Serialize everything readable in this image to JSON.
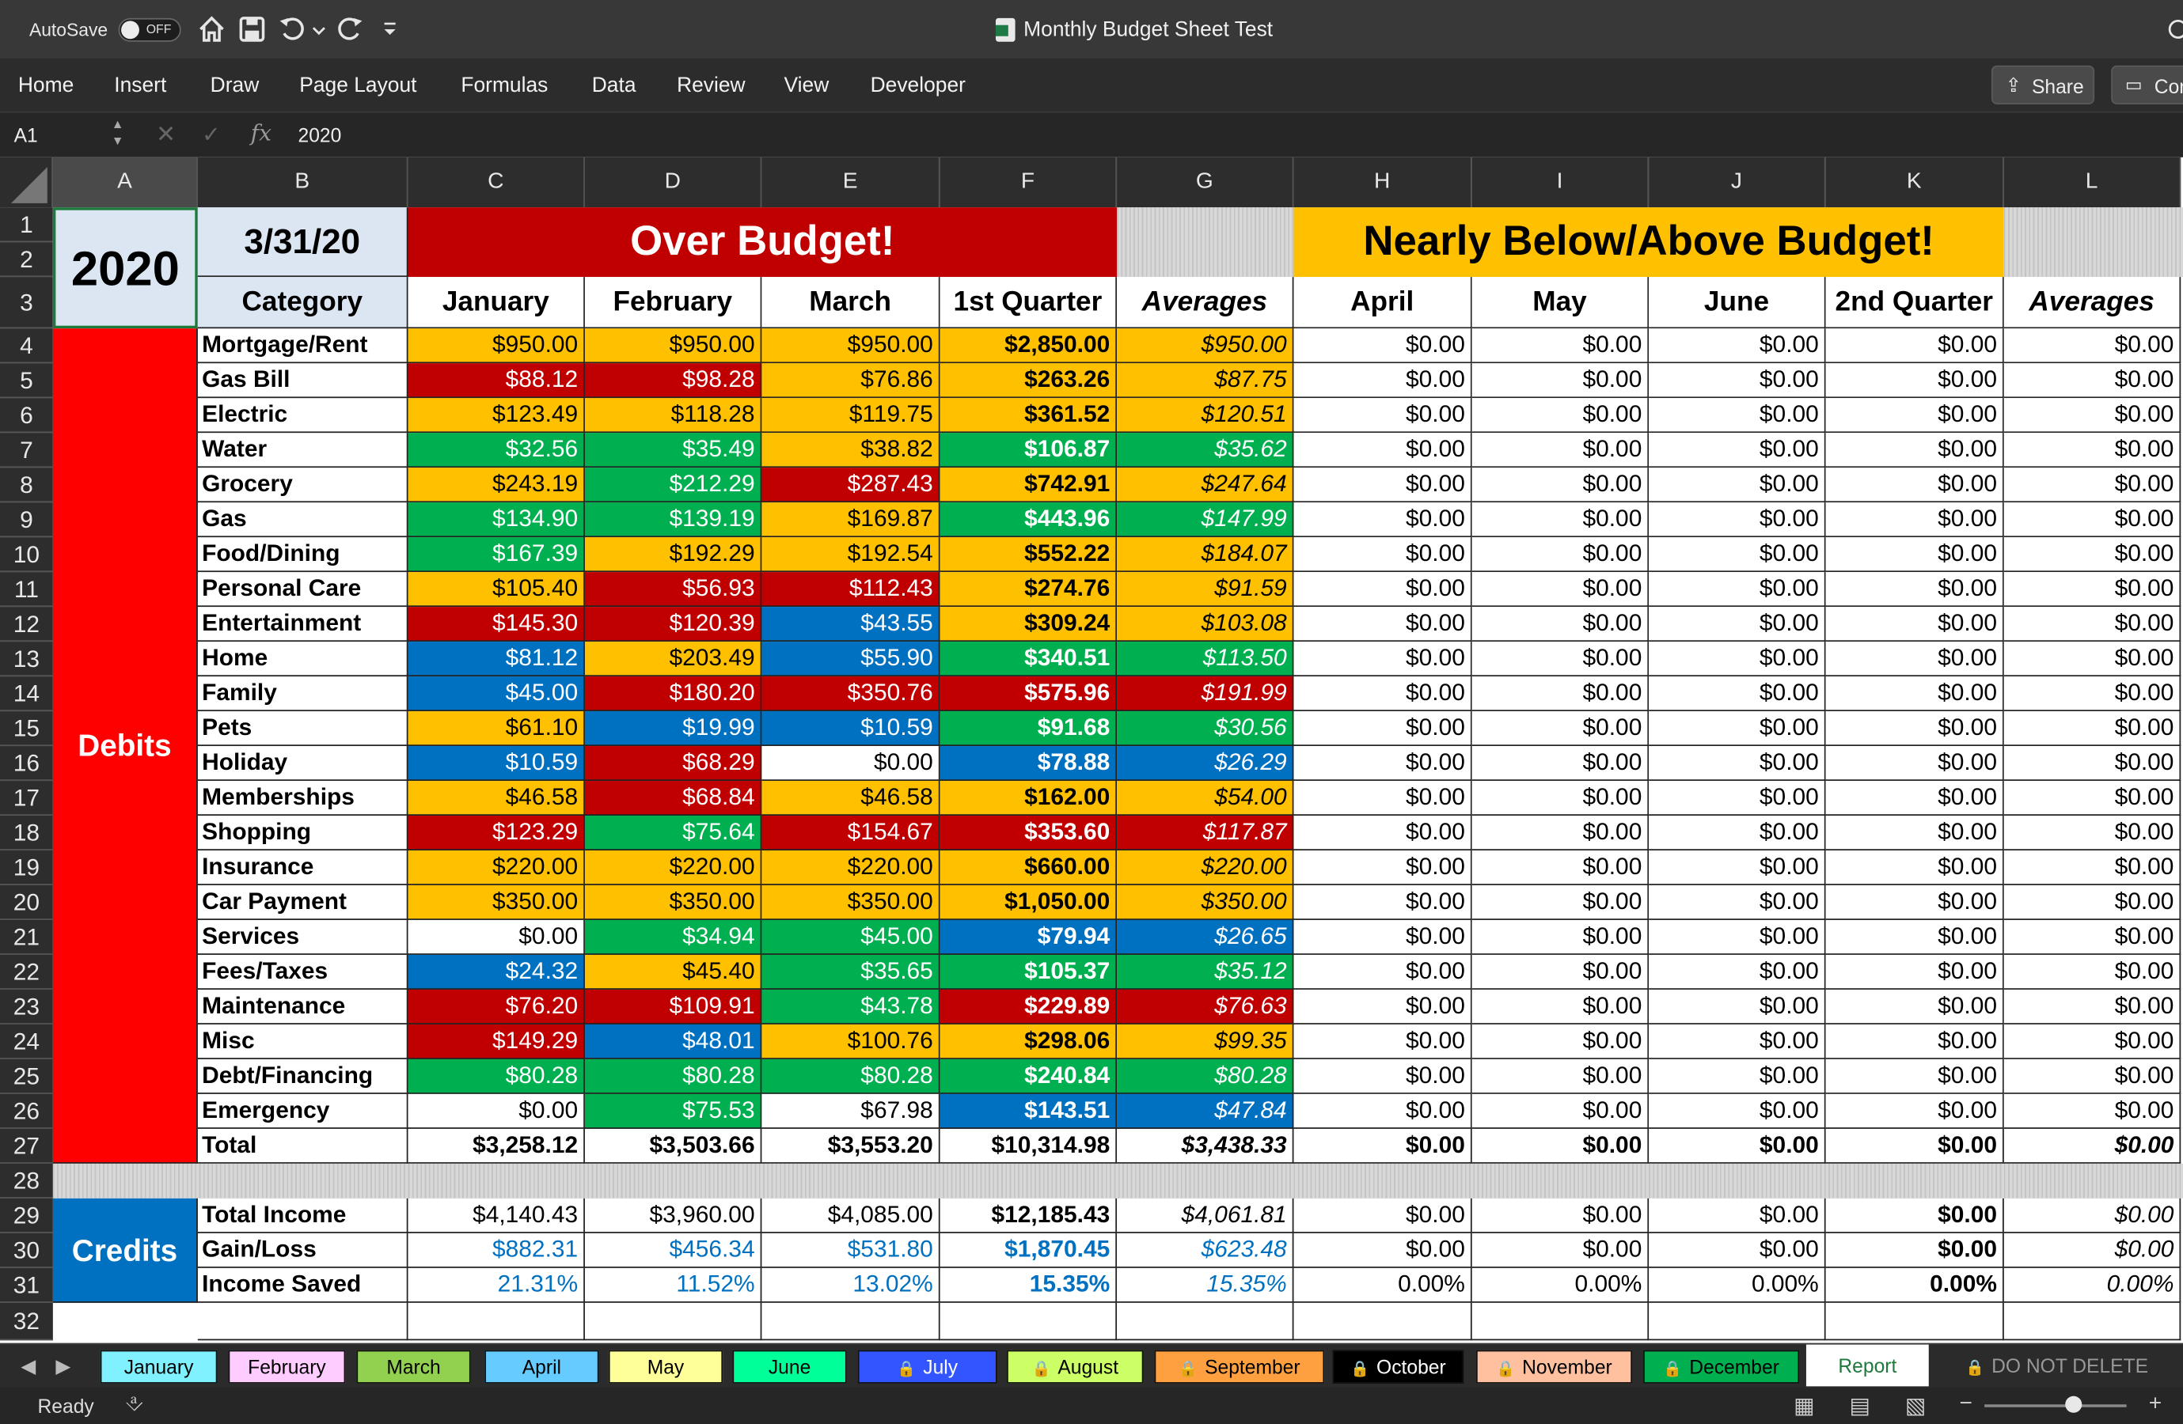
{
  "window": {
    "title": "Monthly Budget Sheet Test",
    "autosave_label": "AutoSave",
    "autosave_state": "OFF"
  },
  "icons": [
    "home-icon",
    "save-icon",
    "undo-icon",
    "redo-icon",
    "customize-icon",
    "share-icon",
    "comment-icon",
    "fx-icon"
  ],
  "ribbon": {
    "tabs": [
      "Home",
      "Insert",
      "Draw",
      "Page Layout",
      "Formulas",
      "Data",
      "Review",
      "View",
      "Developer"
    ],
    "share_label": "Share",
    "comments_label": "Con"
  },
  "formula_bar": {
    "cell_ref": "A1",
    "formula": "2020",
    "fx_label": "fx"
  },
  "columns": [
    "A",
    "B",
    "C",
    "D",
    "E",
    "F",
    "G",
    "H",
    "I",
    "J",
    "K",
    "L"
  ],
  "sheet": {
    "year": "2020",
    "date": "3/31/20",
    "over_banner": "Over Budget!",
    "nearly_banner": "Nearly Below/Above Budget!",
    "headers": [
      "Category",
      "January",
      "February",
      "March",
      "1st Quarter",
      "Averages",
      "April",
      "May",
      "June",
      "2nd Quarter",
      "Averages"
    ],
    "debits_label": "Debits",
    "credits_label": "Credits",
    "debit_rows": [
      {
        "cat": "Mortgage/Rent",
        "v": [
          "$950.00",
          "$950.00",
          "$950.00",
          "$2,850.00",
          "$950.00"
        ],
        "c": [
          "y",
          "y",
          "y",
          "y",
          "y"
        ]
      },
      {
        "cat": "Gas Bill",
        "v": [
          "$88.12",
          "$98.28",
          "$76.86",
          "$263.26",
          "$87.75"
        ],
        "c": [
          "r",
          "r",
          "y",
          "y",
          "y"
        ]
      },
      {
        "cat": "Electric",
        "v": [
          "$123.49",
          "$118.28",
          "$119.75",
          "$361.52",
          "$120.51"
        ],
        "c": [
          "y",
          "y",
          "y",
          "y",
          "y"
        ]
      },
      {
        "cat": "Water",
        "v": [
          "$32.56",
          "$35.49",
          "$38.82",
          "$106.87",
          "$35.62"
        ],
        "c": [
          "g",
          "g",
          "y",
          "g",
          "g"
        ]
      },
      {
        "cat": "Grocery",
        "v": [
          "$243.19",
          "$212.29",
          "$287.43",
          "$742.91",
          "$247.64"
        ],
        "c": [
          "y",
          "g",
          "r",
          "y",
          "y"
        ]
      },
      {
        "cat": "Gas",
        "v": [
          "$134.90",
          "$139.19",
          "$169.87",
          "$443.96",
          "$147.99"
        ],
        "c": [
          "g",
          "g",
          "y",
          "g",
          "g"
        ]
      },
      {
        "cat": "Food/Dining",
        "v": [
          "$167.39",
          "$192.29",
          "$192.54",
          "$552.22",
          "$184.07"
        ],
        "c": [
          "g",
          "y",
          "y",
          "y",
          "y"
        ]
      },
      {
        "cat": "Personal Care",
        "v": [
          "$105.40",
          "$56.93",
          "$112.43",
          "$274.76",
          "$91.59"
        ],
        "c": [
          "y",
          "r",
          "r",
          "y",
          "y"
        ]
      },
      {
        "cat": "Entertainment",
        "v": [
          "$145.30",
          "$120.39",
          "$43.55",
          "$309.24",
          "$103.08"
        ],
        "c": [
          "r",
          "r",
          "b",
          "y",
          "y"
        ]
      },
      {
        "cat": "Home",
        "v": [
          "$81.12",
          "$203.49",
          "$55.90",
          "$340.51",
          "$113.50"
        ],
        "c": [
          "b",
          "y",
          "b",
          "g",
          "g"
        ]
      },
      {
        "cat": "Family",
        "v": [
          "$45.00",
          "$180.20",
          "$350.76",
          "$575.96",
          "$191.99"
        ],
        "c": [
          "b",
          "r",
          "r",
          "r",
          "r"
        ]
      },
      {
        "cat": "Pets",
        "v": [
          "$61.10",
          "$19.99",
          "$10.59",
          "$91.68",
          "$30.56"
        ],
        "c": [
          "y",
          "b",
          "b",
          "g",
          "g"
        ]
      },
      {
        "cat": "Holiday",
        "v": [
          "$10.59",
          "$68.29",
          "$0.00",
          "$78.88",
          "$26.29"
        ],
        "c": [
          "b",
          "r",
          "w",
          "b",
          "b"
        ]
      },
      {
        "cat": "Memberships",
        "v": [
          "$46.58",
          "$68.84",
          "$46.58",
          "$162.00",
          "$54.00"
        ],
        "c": [
          "y",
          "r",
          "y",
          "y",
          "y"
        ]
      },
      {
        "cat": "Shopping",
        "v": [
          "$123.29",
          "$75.64",
          "$154.67",
          "$353.60",
          "$117.87"
        ],
        "c": [
          "r",
          "g",
          "r",
          "r",
          "r"
        ]
      },
      {
        "cat": "Insurance",
        "v": [
          "$220.00",
          "$220.00",
          "$220.00",
          "$660.00",
          "$220.00"
        ],
        "c": [
          "y",
          "y",
          "y",
          "y",
          "y"
        ]
      },
      {
        "cat": "Car Payment",
        "v": [
          "$350.00",
          "$350.00",
          "$350.00",
          "$1,050.00",
          "$350.00"
        ],
        "c": [
          "y",
          "y",
          "y",
          "y",
          "y"
        ]
      },
      {
        "cat": "Services",
        "v": [
          "$0.00",
          "$34.94",
          "$45.00",
          "$79.94",
          "$26.65"
        ],
        "c": [
          "w",
          "g",
          "g",
          "b",
          "b"
        ]
      },
      {
        "cat": "Fees/Taxes",
        "v": [
          "$24.32",
          "$45.40",
          "$35.65",
          "$105.37",
          "$35.12"
        ],
        "c": [
          "b",
          "y",
          "g",
          "g",
          "g"
        ]
      },
      {
        "cat": "Maintenance",
        "v": [
          "$76.20",
          "$109.91",
          "$43.78",
          "$229.89",
          "$76.63"
        ],
        "c": [
          "r",
          "r",
          "g",
          "r",
          "r"
        ]
      },
      {
        "cat": "Misc",
        "v": [
          "$149.29",
          "$48.01",
          "$100.76",
          "$298.06",
          "$99.35"
        ],
        "c": [
          "r",
          "b",
          "y",
          "y",
          "y"
        ]
      },
      {
        "cat": "Debt/Financing",
        "v": [
          "$80.28",
          "$80.28",
          "$80.28",
          "$240.84",
          "$80.28"
        ],
        "c": [
          "g",
          "g",
          "g",
          "g",
          "g"
        ]
      },
      {
        "cat": "Emergency",
        "v": [
          "$0.00",
          "$75.53",
          "$67.98",
          "$143.51",
          "$47.84"
        ],
        "c": [
          "w",
          "g",
          "w",
          "b",
          "b"
        ]
      }
    ],
    "q2_value": "$0.00",
    "total_row": {
      "cat": "Total",
      "v": [
        "$3,258.12",
        "$3,503.66",
        "$3,553.20",
        "$10,314.98",
        "$3,438.33",
        "$0.00",
        "$0.00",
        "$0.00",
        "$0.00",
        "$0.00"
      ]
    },
    "credit_rows": [
      {
        "cat": "Total Income",
        "v": [
          "$4,140.43",
          "$3,960.00",
          "$4,085.00",
          "$12,185.43",
          "$4,061.81",
          "$0.00",
          "$0.00",
          "$0.00",
          "$0.00",
          "$0.00"
        ],
        "blue": false
      },
      {
        "cat": "Gain/Loss",
        "v": [
          "$882.31",
          "$456.34",
          "$531.80",
          "$1,870.45",
          "$623.48",
          "$0.00",
          "$0.00",
          "$0.00",
          "$0.00",
          "$0.00"
        ],
        "blue": true
      },
      {
        "cat": "Income Saved",
        "v": [
          "21.31%",
          "11.52%",
          "13.02%",
          "15.35%",
          "15.35%",
          "0.00%",
          "0.00%",
          "0.00%",
          "0.00%",
          "0.00%"
        ],
        "blue": true
      }
    ],
    "row_numbers": [
      "1",
      "2",
      "3",
      "4",
      "5",
      "6",
      "7",
      "8",
      "9",
      "10",
      "11",
      "12",
      "13",
      "14",
      "15",
      "16",
      "17",
      "18",
      "19",
      "20",
      "21",
      "22",
      "23",
      "24",
      "25",
      "26",
      "27",
      "28",
      "29",
      "30",
      "31",
      "32"
    ]
  },
  "colors": {
    "red": "#c00000",
    "yellow": "#ffc000",
    "green": "#00b050",
    "blue": "#0070c0",
    "bright_red": "#ff0000",
    "header_blue": "#dce6f2"
  },
  "sheet_tabs": [
    {
      "label": "January",
      "bg": "#7ff1ff",
      "lock": false
    },
    {
      "label": "February",
      "bg": "#ffccff",
      "lock": false
    },
    {
      "label": "March",
      "bg": "#92d050",
      "lock": false
    },
    {
      "label": "April",
      "bg": "#66ccff",
      "lock": false
    },
    {
      "label": "May",
      "bg": "#ffff99",
      "lock": false
    },
    {
      "label": "June",
      "bg": "#00ff99",
      "lock": false
    },
    {
      "label": "July",
      "bg": "#3355ff",
      "lock": true
    },
    {
      "label": "August",
      "bg": "#ccff66",
      "lock": true
    },
    {
      "label": "September",
      "bg": "#ffa040",
      "lock": true
    },
    {
      "label": "October",
      "bg": "#000000",
      "lock": true
    },
    {
      "label": "November",
      "bg": "#ffc0a0",
      "lock": true
    },
    {
      "label": "December",
      "bg": "#00b050",
      "lock": true
    },
    {
      "label": "Report",
      "bg": "#ffffff",
      "lock": false,
      "active": true
    },
    {
      "label": "DO NOT DELETE",
      "bg": "#2b2b2b",
      "lock": true
    }
  ],
  "status": {
    "ready": "Ready"
  }
}
